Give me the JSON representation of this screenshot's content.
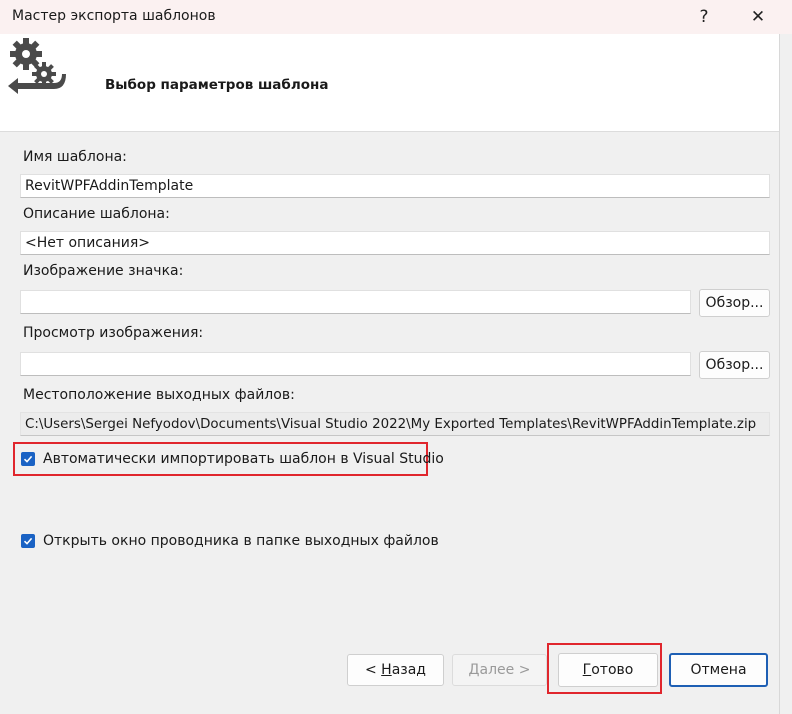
{
  "window": {
    "title": "Мастер экспорта шаблонов",
    "help_glyph": "?",
    "close_glyph": "✕"
  },
  "header": {
    "title": "Выбор параметров шаблона",
    "icon": "gears-arrow-icon"
  },
  "form": {
    "name_label": "Имя шаблона:",
    "name_value": "RevitWPFAddinTemplate",
    "description_label": "Описание шаблона:",
    "description_value": "<Нет описания>",
    "icon_image_label": "Изображение значка:",
    "icon_image_value": "",
    "preview_image_label": "Просмотр изображения:",
    "preview_image_value": "",
    "browse_label": "Обзор...",
    "output_location_label": "Местоположение выходных файлов:",
    "output_location_value": "C:\\Users\\Sergei Nefyodov\\Documents\\Visual Studio 2022\\My Exported Templates\\RevitWPFAddinTemplate.zip",
    "auto_import_label": "Автоматически импортировать шаблон в Visual Studio",
    "auto_import_checked": true,
    "open_explorer_label": "Открыть окно проводника в папке выходных файлов",
    "open_explorer_checked": true
  },
  "footer": {
    "back_arrow": "<",
    "back_key": "Н",
    "back_rest": "азад",
    "next_key": "Д",
    "next_rest": "алее",
    "next_arrow": ">",
    "finish_key": "Г",
    "finish_rest": "отово",
    "cancel_label": "Отмена"
  },
  "colors": {
    "accent": "#1a62c4",
    "highlight": "#e0262d",
    "title_bar": "#fbf1f1"
  }
}
